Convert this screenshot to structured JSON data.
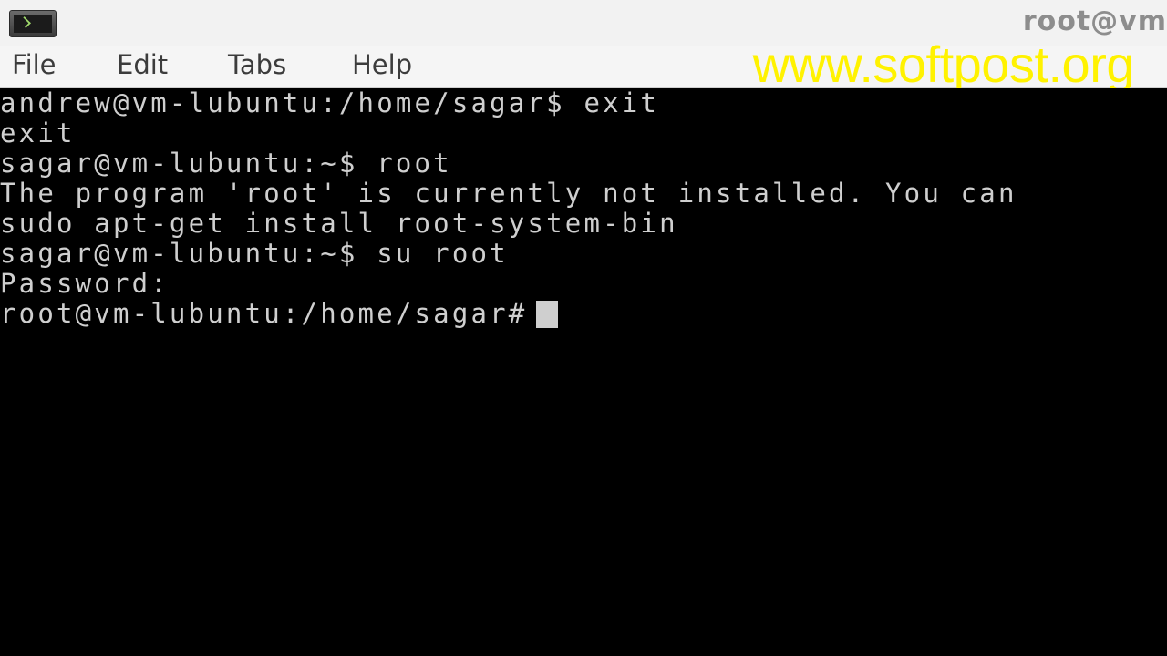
{
  "window": {
    "title": "root@vm",
    "app_icon": "terminal-icon"
  },
  "menu": {
    "items": [
      "File",
      "Edit",
      "Tabs",
      "Help"
    ]
  },
  "watermark": "www.softpost.org",
  "terminal": {
    "lines": [
      "andrew@vm-lubuntu:/home/sagar$ exit",
      "exit",
      "sagar@vm-lubuntu:~$ root",
      "The program 'root' is currently not installed. You can",
      "sudo apt-get install root-system-bin",
      "sagar@vm-lubuntu:~$ su root",
      "Password:",
      "root@vm-lubuntu:/home/sagar#"
    ],
    "colors": {
      "background": "#000000",
      "text": "#cfcfcf"
    }
  }
}
